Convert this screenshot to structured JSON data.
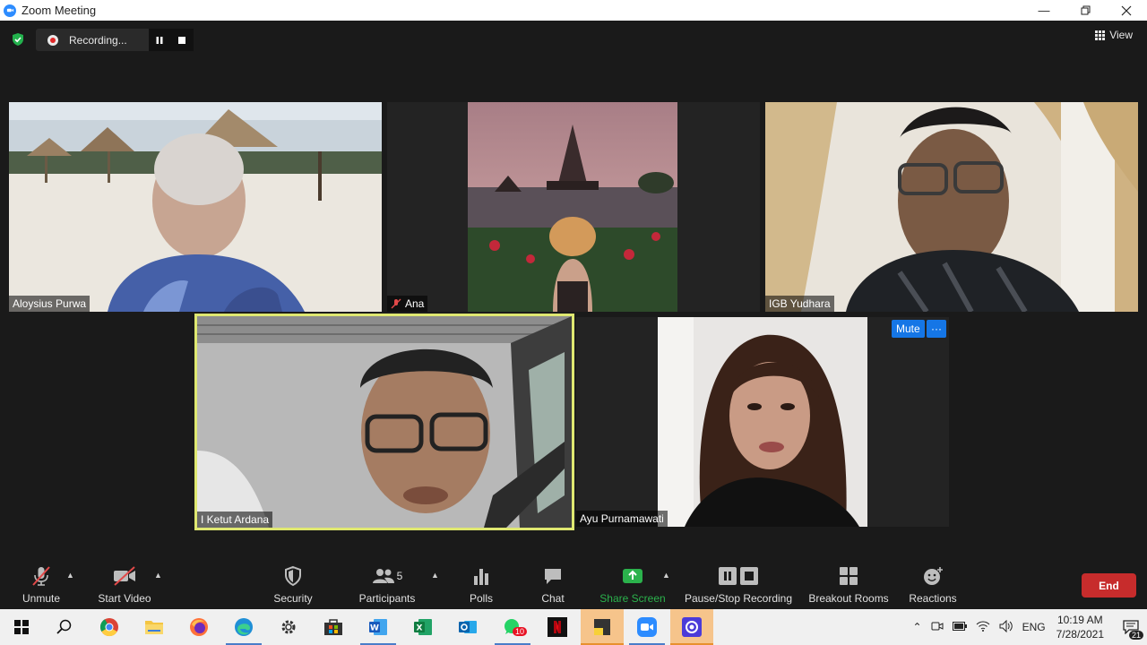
{
  "window": {
    "title": "Zoom Meeting"
  },
  "top": {
    "recording_label": "Recording...",
    "view_label": "View"
  },
  "participants": [
    {
      "name": "Aloysius Purwa",
      "muted": false
    },
    {
      "name": "Ana",
      "muted": true
    },
    {
      "name": "IGB Yudhara",
      "muted": false
    },
    {
      "name": "I Ketut Ardana",
      "muted": false,
      "speaking": true
    },
    {
      "name": "Ayu Purnamawati",
      "muted": false
    }
  ],
  "hover": {
    "mute_label": "Mute",
    "more_label": "···"
  },
  "toolbar": {
    "unmute": "Unmute",
    "start_video": "Start Video",
    "security": "Security",
    "participants": "Participants",
    "participants_count": "5",
    "polls": "Polls",
    "chat": "Chat",
    "share_screen": "Share Screen",
    "pause_stop_recording": "Pause/Stop Recording",
    "breakout_rooms": "Breakout Rooms",
    "reactions": "Reactions",
    "end": "End"
  },
  "taskbar": {
    "whatsapp_badge": "10",
    "lang": "ENG",
    "time": "10:19 AM",
    "date": "7/28/2021",
    "notification_count": "21"
  },
  "colors": {
    "accent": "#2d8cff",
    "share_green": "#2bb24c",
    "end_red": "#c72c2c",
    "speaker_border": "#dfe871"
  }
}
